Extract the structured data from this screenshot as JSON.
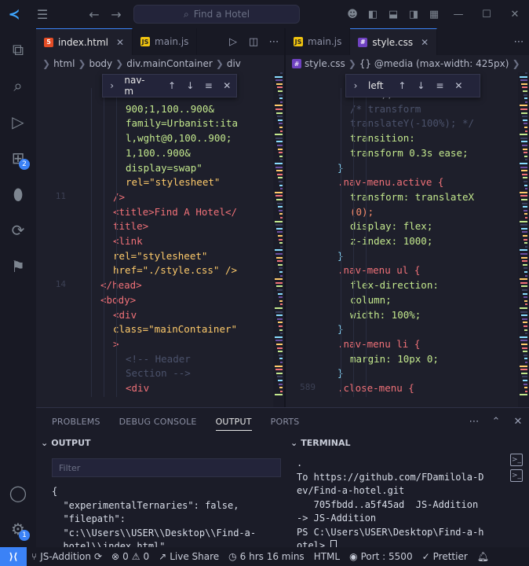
{
  "titlebar": {
    "search_placeholder": "Find a Hotel"
  },
  "editor1": {
    "tabs": [
      {
        "label": "index.html",
        "type": "html",
        "active": true
      },
      {
        "label": "main.js",
        "type": "js",
        "active": false
      }
    ],
    "breadcrumb": [
      "html",
      "body",
      "div.mainContainer",
      "div"
    ],
    "find": {
      "term": "nav-m"
    },
    "lines": [
      [
        "",
        "<link"
      ],
      [
        "",
        "900;1,100..900&"
      ],
      [
        "",
        "family=Urbanist:ita"
      ],
      [
        "",
        "l,wght@0,100..900;"
      ],
      [
        "",
        "1,100..900&"
      ],
      [
        "",
        "display=swap\""
      ],
      [
        "",
        "rel=\"stylesheet\""
      ],
      [
        "11",
        "/>"
      ],
      [
        "",
        "<title>Find A Hotel</"
      ],
      [
        "",
        "title>"
      ],
      [
        "",
        "<link"
      ],
      [
        "",
        "rel=\"stylesheet\""
      ],
      [
        "",
        "href=\"./style.css\" />"
      ],
      [
        "14",
        "</head>"
      ],
      [
        "",
        "<body>"
      ],
      [
        "",
        "<div"
      ],
      [
        "",
        "class=\"mainContainer\""
      ],
      [
        "",
        ">"
      ],
      [
        "",
        "<!-- Header"
      ],
      [
        "",
        "Section -->"
      ],
      [
        "",
        "<div"
      ]
    ]
  },
  "editor2": {
    "tabs": [
      {
        "label": "main.js",
        "type": "js",
        "active": false
      },
      {
        "label": "style.css",
        "type": "css",
        "active": true
      }
    ],
    "breadcrumb": [
      "style.css",
      "{} @media (max-width: 425px)"
    ],
    "find": {
      "term": "left"
    },
    "lines": [
      [
        "",
        "5);"
      ],
      [
        "",
        "/* transform"
      ],
      [
        "",
        "translateY(-100%); */"
      ],
      [
        "",
        "transition:"
      ],
      [
        "",
        "transform 0.3s ease;"
      ],
      [
        "",
        "}"
      ],
      [
        "",
        ".nav-menu.active {"
      ],
      [
        "",
        "transform: translateX"
      ],
      [
        "",
        "(0);"
      ],
      [
        "",
        "display: flex;"
      ],
      [
        "",
        "z-index: 1000;"
      ],
      [
        "",
        "}"
      ],
      [
        "",
        ".nav-menu ul {"
      ],
      [
        "",
        "flex-direction:"
      ],
      [
        "",
        "column;"
      ],
      [
        "",
        "width: 100%;"
      ],
      [
        "",
        "}"
      ],
      [
        "",
        ".nav-menu li {"
      ],
      [
        "",
        "margin: 10px 0;"
      ],
      [
        "",
        "}"
      ],
      [
        "589",
        ".close-menu {"
      ]
    ]
  },
  "panel": {
    "tabs": [
      "PROBLEMS",
      "DEBUG CONSOLE",
      "OUTPUT",
      "PORTS"
    ],
    "active_tab": "OUTPUT",
    "output": {
      "title": "OUTPUT",
      "filter_placeholder": "Filter",
      "text": "{\n  \"experimentalTernaries\": false,\n  \"filepath\":\n  \"c:\\\\Users\\\\USER\\\\Desktop\\\\Find-a-\n  hotel\\\\index.html\","
    },
    "terminal": {
      "title": "TERMINAL",
      "text": ".\nTo https://github.com/FDamilola-D\nev/Find-a-hotel.git\n   705fbdd..a5f45ad  JS-Addition\n-> JS-Addition\nPS C:\\Users\\USER\\Desktop\\Find-a-h\notel> "
    }
  },
  "activity": {
    "source_control_badge": "2",
    "accounts_badge": "1"
  },
  "statusbar": {
    "branch": "JS-Addition",
    "errors": "0",
    "warnings": "0",
    "live_share": "Live Share",
    "time": "6 hrs 16 mins",
    "language": "HTML",
    "port": "Port : 5500",
    "prettier": "Prettier"
  },
  "colors": {
    "accent": "#3b82f6",
    "background": "#1e1f2b",
    "chrome": "#181924"
  }
}
